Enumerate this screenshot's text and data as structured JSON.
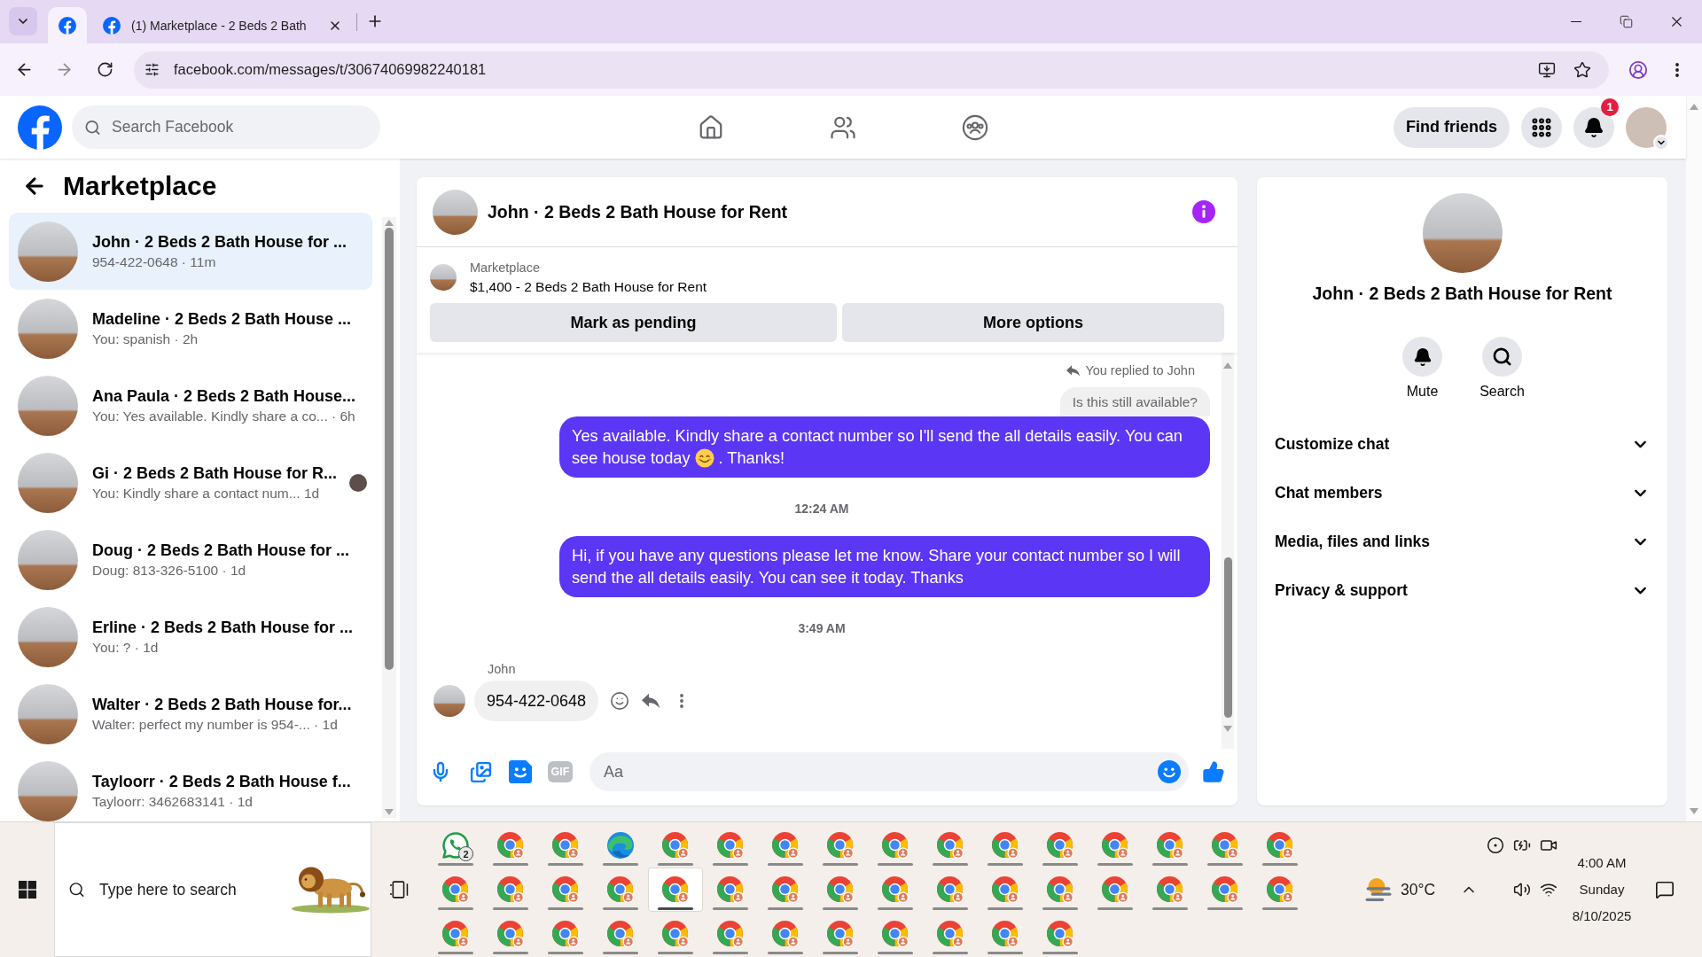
{
  "browser": {
    "tabs": [
      {
        "kind": "pinned",
        "selected": true
      },
      {
        "kind": "page",
        "title": "(1) Marketplace - 2 Beds 2 Bath",
        "selected": false
      }
    ],
    "url": "facebook.com/messages/t/30674069982240181"
  },
  "header": {
    "search_placeholder": "Search Facebook",
    "nav": [
      {
        "kind": "home",
        "selected": false
      },
      {
        "kind": "friends",
        "selected": false
      },
      {
        "kind": "groups",
        "selected": false
      }
    ],
    "find_friends": "Find friends",
    "notifications": "1"
  },
  "sidebar": {
    "title": "Marketplace",
    "conversations": [
      {
        "name": "John · 2 Beds 2 Bath House for ...",
        "preview": "954-422-0648 · 11m",
        "selected": true,
        "seen": false
      },
      {
        "name": "Madeline · 2 Beds 2 Bath House ...",
        "preview": "You: spanish · 2h",
        "selected": false,
        "seen": false
      },
      {
        "name": "Ana Paula · 2 Beds 2 Bath House...",
        "preview": "You: Yes available. Kindly share a co... · 6h",
        "selected": false,
        "seen": false
      },
      {
        "name": "Gi · 2 Beds 2 Bath House for R...",
        "preview": "You: Kindly share a contact num... 1d",
        "selected": false,
        "seen": true
      },
      {
        "name": "Doug · 2 Beds 2 Bath House for ...",
        "preview": "Doug: 813-326-5100 · 1d",
        "selected": false,
        "seen": false
      },
      {
        "name": "Erline · 2 Beds 2 Bath House for ...",
        "preview": "You: ? · 1d",
        "selected": false,
        "seen": false
      },
      {
        "name": "Walter · 2 Beds 2 Bath House for...",
        "preview": "Walter: perfect my number is 954-... · 1d",
        "selected": false,
        "seen": false
      },
      {
        "name": "Tayloorr · 2 Beds 2 Bath House f...",
        "preview": "Tayloorr: 3462683141 · 1d",
        "selected": false,
        "seen": false
      }
    ]
  },
  "chat": {
    "title": "John · 2 Beds 2 Bath House for Rent",
    "listing": {
      "source": "Marketplace",
      "title": "$1,400 - 2 Beds 2 Bath House for Rent"
    },
    "actions": [
      "Mark as pending",
      "More options"
    ],
    "messages": [
      {
        "kind": "reply_context",
        "label": "You replied to John",
        "quote": "Is this still available?"
      },
      {
        "kind": "outgoing",
        "segments": [
          {
            "kind": "text",
            "text": "Yes available. Kindly share a contact number so I'll send the all details easily. You can see house today "
          },
          {
            "kind": "emoji"
          },
          {
            "kind": "text",
            "text": " . Thanks!"
          }
        ]
      },
      {
        "kind": "timestamp",
        "text": "12:24 AM"
      },
      {
        "kind": "outgoing",
        "segments": [
          {
            "kind": "text",
            "text": "Hi, if you have any questions please let me know. Share your contact number so I will send the all details easily. You can see it today. Thanks"
          }
        ]
      },
      {
        "kind": "timestamp",
        "text": "3:49 AM"
      },
      {
        "kind": "incoming",
        "sender": "John",
        "text": "954-422-0648"
      }
    ],
    "composer": {
      "gif": "GIF",
      "placeholder": "Aa"
    }
  },
  "details": {
    "title": "John · 2 Beds 2 Bath House for Rent",
    "actions": [
      {
        "kind": "mute",
        "label": "Mute"
      },
      {
        "kind": "search",
        "label": "Search"
      }
    ],
    "sections": [
      {
        "label": "Customize chat",
        "expanded": false
      },
      {
        "label": "Chat members",
        "expanded": false
      },
      {
        "label": "Media, files and links",
        "expanded": false
      },
      {
        "label": "Privacy & support",
        "expanded": false
      }
    ]
  },
  "taskbar": {
    "search_placeholder": "Type here to search",
    "apps": [
      {
        "kind": "whatsapp",
        "badge": "2",
        "selected": false
      },
      {
        "kind": "chrome",
        "selected": false
      },
      {
        "kind": "chrome",
        "selected": false
      },
      {
        "kind": "edge",
        "selected": false
      },
      {
        "kind": "chrome",
        "selected": false
      },
      {
        "kind": "chrome",
        "selected": false
      },
      {
        "kind": "chrome",
        "selected": false
      },
      {
        "kind": "chrome",
        "selected": false
      },
      {
        "kind": "chrome",
        "selected": false
      },
      {
        "kind": "chrome",
        "selected": false
      },
      {
        "kind": "chrome",
        "selected": false
      },
      {
        "kind": "chrome",
        "selected": false
      },
      {
        "kind": "chrome",
        "selected": false
      },
      {
        "kind": "chrome",
        "selected": false
      },
      {
        "kind": "chrome",
        "selected": false
      },
      {
        "kind": "chrome",
        "selected": false
      },
      {
        "kind": "chrome",
        "selected": false
      },
      {
        "kind": "chrome",
        "selected": false
      },
      {
        "kind": "chrome",
        "selected": false
      },
      {
        "kind": "chrome",
        "selected": false
      },
      {
        "kind": "chrome",
        "selected": true
      },
      {
        "kind": "chrome",
        "selected": false
      },
      {
        "kind": "chrome",
        "selected": false
      },
      {
        "kind": "chrome",
        "selected": false
      },
      {
        "kind": "chrome",
        "selected": false
      },
      {
        "kind": "chrome",
        "selected": false
      },
      {
        "kind": "chrome",
        "selected": false
      },
      {
        "kind": "chrome",
        "selected": false
      },
      {
        "kind": "chrome",
        "selected": false
      },
      {
        "kind": "chrome",
        "selected": false
      },
      {
        "kind": "chrome",
        "selected": false
      },
      {
        "kind": "chrome",
        "selected": false
      },
      {
        "kind": "chrome",
        "selected": false
      },
      {
        "kind": "chrome",
        "selected": false
      },
      {
        "kind": "chrome",
        "selected": false
      },
      {
        "kind": "chrome",
        "selected": false
      },
      {
        "kind": "chrome",
        "selected": false
      },
      {
        "kind": "chrome",
        "selected": false
      },
      {
        "kind": "chrome",
        "selected": false
      },
      {
        "kind": "chrome",
        "selected": false
      },
      {
        "kind": "chrome",
        "selected": false
      },
      {
        "kind": "chrome",
        "selected": false
      },
      {
        "kind": "chrome",
        "selected": false
      },
      {
        "kind": "chrome",
        "selected": false
      }
    ],
    "weather": "30°C",
    "clock": {
      "time": "4:00 AM",
      "day": "Sunday",
      "date": "8/10/2025"
    }
  }
}
